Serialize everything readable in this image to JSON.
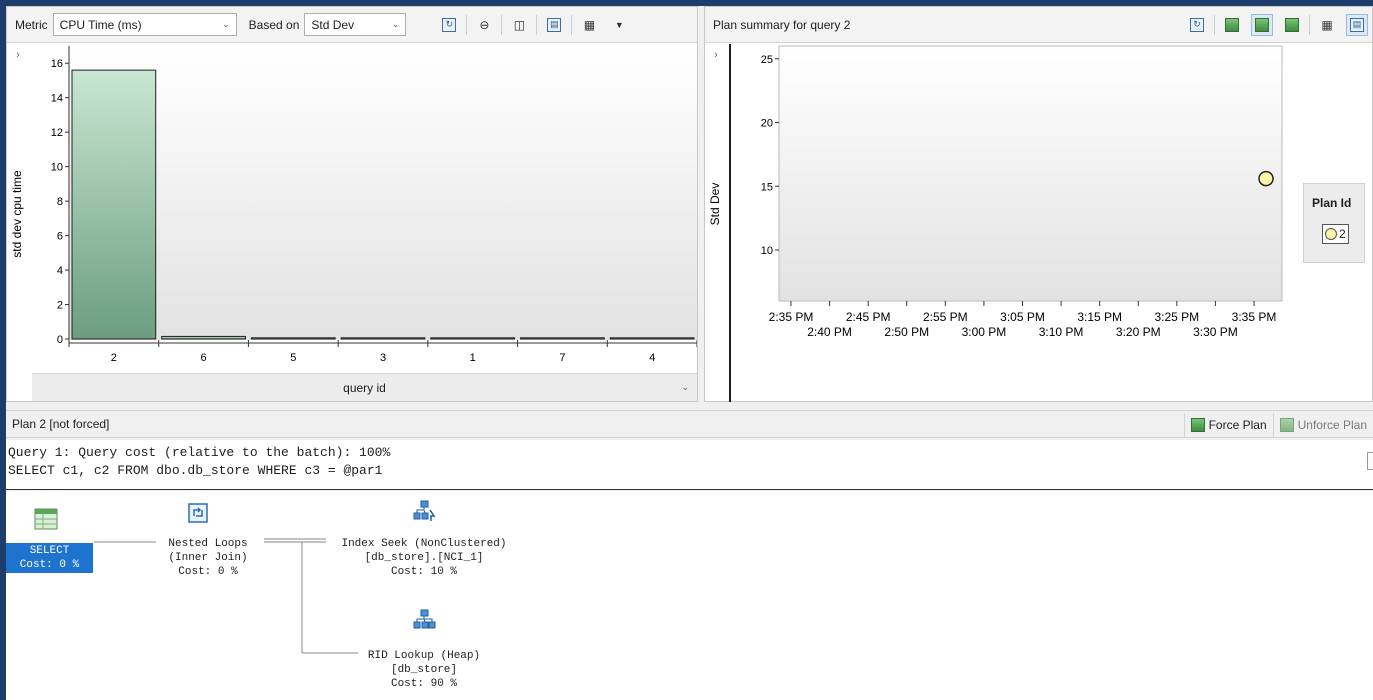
{
  "top_left_toolbar": {
    "metric_label": "Metric",
    "metric_value": "CPU Time (ms)",
    "based_on_label": "Based on",
    "based_on_value": "Std Dev",
    "buttons": [
      "refresh-icon",
      "compare-icon",
      "track-query-icon",
      "view-grid-icon",
      "view-chart-icon",
      "overflow-icon"
    ]
  },
  "top_right_toolbar": {
    "title": "Plan summary for query 2",
    "buttons": [
      "refresh-icon",
      "force-plan-icon",
      "unforce-plan-icon",
      "compare-plans-icon",
      "grid-icon",
      "chart-icon"
    ]
  },
  "chart_data": [
    {
      "type": "bar",
      "ylabel": "std dev cpu time",
      "xlabel": "query id",
      "categories": [
        "2",
        "6",
        "5",
        "3",
        "1",
        "7",
        "4"
      ],
      "values": [
        15.6,
        0.15,
        0.05,
        0.05,
        0.05,
        0.05,
        0.05
      ],
      "ylim": [
        0,
        17
      ],
      "yticks": [
        "0",
        "2",
        "4",
        "6",
        "8",
        "10",
        "12",
        "14",
        "16"
      ],
      "colors": {
        "bar": "#8cbf9e",
        "bar_border": "#1e1e1e"
      }
    },
    {
      "type": "scatter",
      "ylabel": "Std Dev",
      "ylim": [
        6,
        26
      ],
      "yticks": [
        "10",
        "15",
        "20",
        "25"
      ],
      "xticks_top": [
        "2:35 PM",
        "2:45 PM",
        "2:55 PM",
        "3:05 PM",
        "3:15 PM",
        "3:25 PM",
        "3:35 PM"
      ],
      "xticks_bottom": [
        "2:40 PM",
        "2:50 PM",
        "3:00 PM",
        "3:10 PM",
        "3:20 PM",
        "3:30 PM"
      ],
      "xlim_minutes": [
        0,
        63
      ],
      "series": [
        {
          "name": "2",
          "points": [
            {
              "x": 61,
              "y": 15.6
            }
          ]
        }
      ],
      "legend_title": "Plan Id",
      "legend_placement": "right",
      "colors": {
        "point": "#fbf5a8"
      }
    }
  ],
  "plan_bar": {
    "title": "Plan 2 [not forced]",
    "force_plan_label": "Force Plan",
    "unforce_plan_label": "Unforce Plan"
  },
  "sql": {
    "line1": "Query 1: Query cost (relative to the batch): 100%",
    "line2": "SELECT c1, c2 FROM dbo.db_store WHERE c3 = @par1"
  },
  "plan_nodes": {
    "select": {
      "name": "SELECT",
      "cost": "Cost: 0 %"
    },
    "nested_loops": {
      "name": "Nested Loops",
      "detail": "(Inner Join)",
      "cost": "Cost: 0 %"
    },
    "index_seek": {
      "name": "Index Seek (NonClustered)",
      "detail": "[db_store].[NCI_1]",
      "cost": "Cost: 10 %"
    },
    "rid_lookup": {
      "name": "RID Lookup (Heap)",
      "detail": "[db_store]",
      "cost": "Cost: 90 %"
    }
  }
}
